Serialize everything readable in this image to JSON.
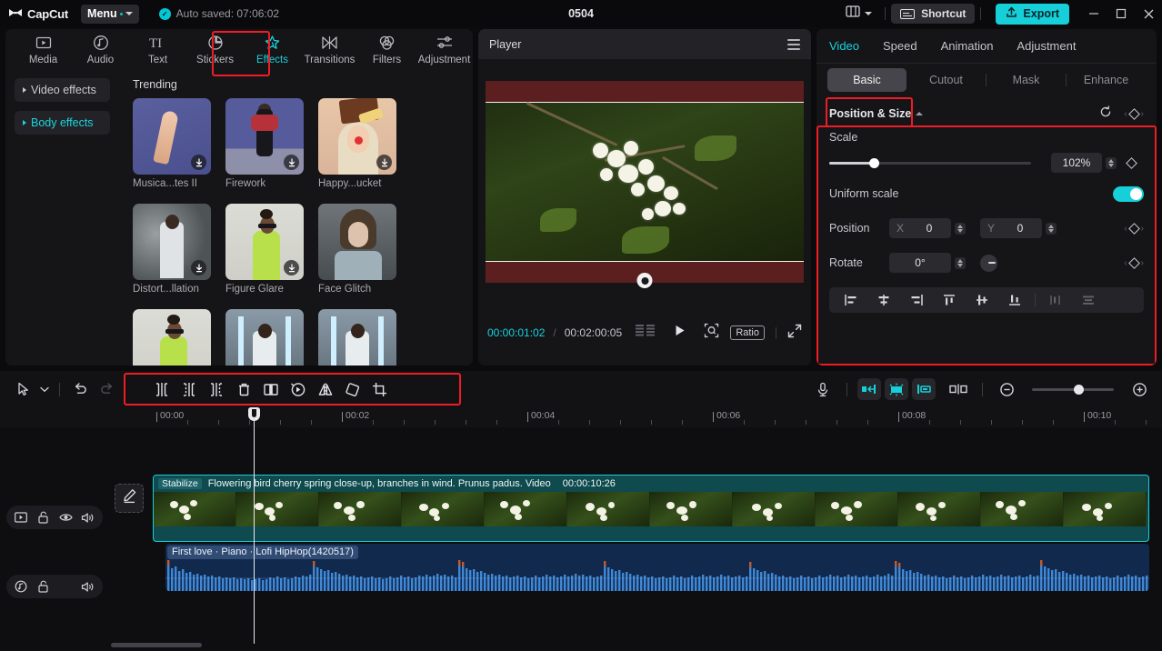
{
  "titlebar": {
    "brand": "CapCut",
    "menu_label": "Menu",
    "autosave_text": "Auto  saved: 07:06:02",
    "project_title": "0504",
    "layout_icon": "layout-icon",
    "shortcut_label": "Shortcut",
    "export_label": "Export",
    "minimize_icon": "minimize-icon",
    "maximize_icon": "maximize-icon",
    "close_icon": "close-icon"
  },
  "left_panel": {
    "nav_tabs": [
      {
        "label": "Media",
        "icon": "media-icon",
        "active": false
      },
      {
        "label": "Audio",
        "icon": "audio-icon",
        "active": false
      },
      {
        "label": "Text",
        "icon": "text-icon",
        "active": false
      },
      {
        "label": "Stickers",
        "icon": "stickers-icon",
        "active": false
      },
      {
        "label": "Effects",
        "icon": "effects-icon",
        "active": true
      },
      {
        "label": "Transitions",
        "icon": "transitions-icon",
        "active": false
      },
      {
        "label": "Filters",
        "icon": "filters-icon",
        "active": false
      },
      {
        "label": "Adjustment",
        "icon": "adjustment-icon",
        "active": false
      }
    ],
    "side_items": [
      {
        "label": "Video effects",
        "selected": false
      },
      {
        "label": "Body effects",
        "selected": true
      }
    ],
    "grid_title": "Trending",
    "effects": [
      {
        "label": "Musica...tes II",
        "art": "th-arm"
      },
      {
        "label": "Firework",
        "art": "th-fw"
      },
      {
        "label": "Happy...ucket",
        "art": "th-happy"
      },
      {
        "label": "Distort...llation",
        "art": "th-dist"
      },
      {
        "label": "Figure Glare",
        "art": "th-glare"
      },
      {
        "label": "Face Glitch",
        "art": "th-face"
      },
      {
        "label": "",
        "art": "th-glare"
      },
      {
        "label": "",
        "art": "th-blue"
      },
      {
        "label": "",
        "art": "th-blue"
      }
    ]
  },
  "player": {
    "title": "Player",
    "menu_icon": "hamburger-icon",
    "current_time": "00:00:01:02",
    "time_separator": "/",
    "total_time": "00:02:00:05",
    "frames_icon": "frames-icon",
    "play_icon": "play-icon",
    "zoom_icon": "magnifier-icon",
    "ratio_label": "Ratio",
    "fullscreen_icon": "fullscreen-icon",
    "rotate_handle_icon": "rotate-handle-icon"
  },
  "right_panel": {
    "tabs": [
      {
        "label": "Video",
        "active": true
      },
      {
        "label": "Speed",
        "active": false
      },
      {
        "label": "Animation",
        "active": false
      },
      {
        "label": "Adjustment",
        "active": false
      }
    ],
    "sub_tabs": [
      {
        "label": "Basic",
        "active": true
      },
      {
        "label": "Cutout",
        "active": false
      },
      {
        "label": "Mask",
        "active": false
      },
      {
        "label": "Enhance",
        "active": false
      }
    ],
    "section": {
      "title": "Position & Size",
      "reset_icon": "reset-icon",
      "keyframe_icon": "keyframe-diamond-icon"
    },
    "scale": {
      "label": "Scale",
      "value": "102%",
      "slider_percent": 21
    },
    "uniform_scale": {
      "label": "Uniform scale",
      "enabled": true
    },
    "position": {
      "label": "Position",
      "x_axis": "X",
      "x_value": "0",
      "y_axis": "Y",
      "y_value": "0"
    },
    "rotate": {
      "label": "Rotate",
      "value": "0°",
      "dial_icon": "rotate-dial-icon"
    },
    "align_buttons": [
      {
        "icon": "align-left-icon",
        "dim": false
      },
      {
        "icon": "align-center-horizontal-icon",
        "dim": false
      },
      {
        "icon": "align-right-icon",
        "dim": false
      },
      {
        "icon": "align-top-icon",
        "dim": false
      },
      {
        "icon": "align-middle-vertical-icon",
        "dim": false
      },
      {
        "icon": "align-bottom-icon",
        "dim": false
      },
      {
        "icon": "distribute-horizontal-icon",
        "dim": true
      },
      {
        "icon": "distribute-vertical-icon",
        "dim": true
      }
    ]
  },
  "toolbar": {
    "left_tools": [
      {
        "icon": "select-arrow-icon",
        "dim": false
      },
      {
        "icon": "chevron-down-icon",
        "dim": false
      },
      {
        "icon": "undo-icon",
        "dim": false
      },
      {
        "icon": "redo-icon",
        "dim": true
      }
    ],
    "edit_tools": [
      {
        "icon": "split-icon",
        "dim": false
      },
      {
        "icon": "split-left-icon",
        "dim": false
      },
      {
        "icon": "split-right-icon",
        "dim": false
      },
      {
        "icon": "delete-icon",
        "dim": false
      },
      {
        "icon": "freeze-icon",
        "dim": false
      },
      {
        "icon": "reverse-icon",
        "dim": false
      },
      {
        "icon": "mirror-icon",
        "dim": false
      },
      {
        "icon": "rotate-icon",
        "dim": false
      },
      {
        "icon": "crop-icon",
        "dim": false
      }
    ],
    "right_tools": [
      {
        "icon": "microphone-icon",
        "accent": false
      },
      {
        "icon": "clip-in-icon",
        "accent": true
      },
      {
        "icon": "auto-adjust-icon",
        "accent": true
      },
      {
        "icon": "clip-out-icon",
        "accent": true
      },
      {
        "icon": "snap-split-icon",
        "accent": false
      }
    ],
    "zoom_out_icon": "zoom-out-icon",
    "zoom_in_icon": "zoom-in-icon",
    "zoom_percent": 50
  },
  "timeline": {
    "ruler_labels": [
      "00:00",
      "00:02",
      "00:04",
      "00:06",
      "00:08",
      "00:10"
    ],
    "video_track": {
      "head_icons": [
        "track-video-icon",
        "unlock-icon",
        "eye-icon",
        "volume-icon"
      ],
      "edit_chip_icon": "pencil-icon",
      "stabilize_label": "Stabilize",
      "clip_name": "Flowering bird cherry spring close-up, branches in wind. Prunus padus. Video",
      "duration": "00:00:10:26"
    },
    "audio_track": {
      "head_icons": [
        "track-audio-icon",
        "unlock-icon",
        "blank-icon",
        "volume-icon"
      ],
      "clip_name": "First love · Piano · Lofi HipHop(1420517)"
    }
  },
  "colors": {
    "accent_cyan": "#16cfd8",
    "highlight_red": "#ee1c25",
    "video_clip": "#0f4a4e",
    "audio_clip": "#11294d",
    "panel_bg": "#151518"
  }
}
